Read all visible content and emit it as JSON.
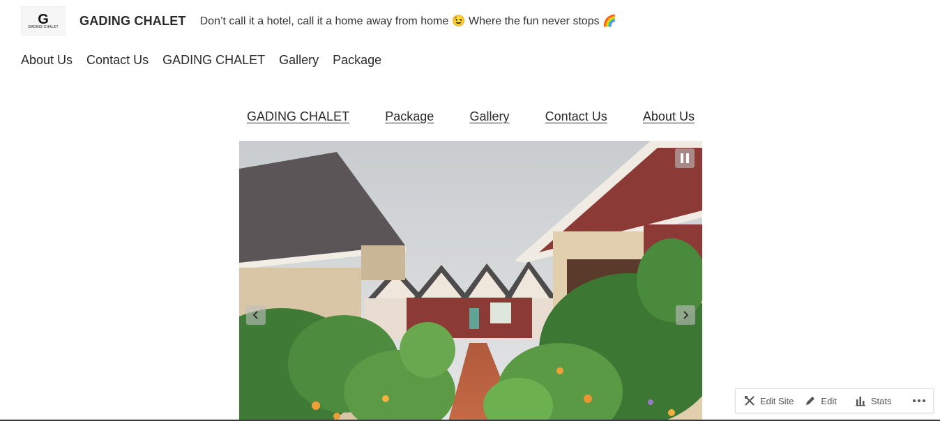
{
  "header": {
    "logo": {
      "letter": "G",
      "text": "GADING CHALET"
    },
    "site_title": "GADING CHALET",
    "tagline": "Don’t call it a hotel, call it a home away from home 😉 Where the fun never stops 🌈"
  },
  "top_nav": [
    "About Us",
    "Contact Us",
    "GADING CHALET",
    "Gallery",
    "Package"
  ],
  "mid_nav": [
    "GADING CHALET",
    "Package",
    "Gallery",
    "Contact Us",
    "About Us"
  ],
  "slideshow": {
    "icons": {
      "pause": "pause-icon",
      "prev": "chevron-left-icon",
      "next": "chevron-right-icon"
    }
  },
  "toolbar": {
    "edit_site": "Edit Site",
    "edit": "Edit",
    "stats": "Stats",
    "more_icon": "more-horizontal-icon"
  },
  "colors": {
    "text": "#2a2a2a",
    "background": "#ffffff",
    "roof_red": "#8b3a36"
  }
}
